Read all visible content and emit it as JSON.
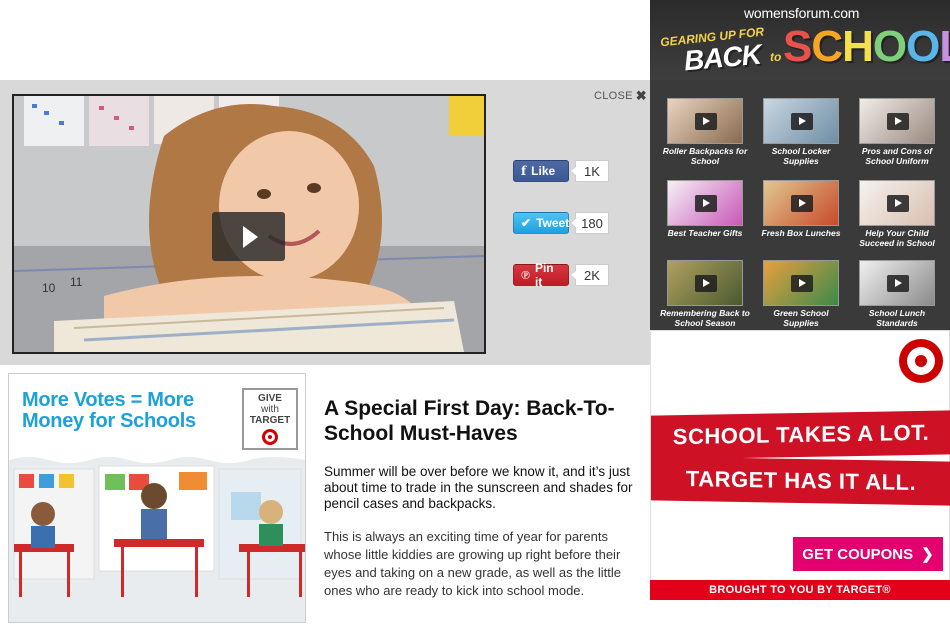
{
  "close": {
    "label": "CLOSE",
    "icon": "close-icon"
  },
  "video": {
    "play_icon": "play-icon"
  },
  "social": {
    "facebook": {
      "label": "Like",
      "count": "1K",
      "icon": "facebook-icon",
      "color": "#3b5998"
    },
    "twitter": {
      "label": "Tweet",
      "count": "180",
      "icon": "twitter-icon",
      "color": "#1ea1e0"
    },
    "pinterest": {
      "label": "Pin it",
      "count": "2K",
      "icon": "pinterest-icon",
      "color": "#bd1e26"
    }
  },
  "promo": {
    "headline_line1": "More Votes = More",
    "headline_line2": "Money for Schools",
    "badge_line1": "GIVE",
    "badge_line2": "with",
    "badge_line3": "TARGET"
  },
  "article": {
    "title": "A Special First Day: Back-To-School Must-Haves",
    "lead": "Summer will be over before we know it, and it’s just about time to trade in the sunscreen and shades for pencil cases and backpacks.",
    "body": "This is always an exciting time of year for parents whose little kiddies are growing up right before their eyes and taking on a new grade, as well as the little ones who are ready to kick into school mode."
  },
  "sidebar": {
    "logo": "womensforum.com",
    "banner_line1": "GEARING UP FOR",
    "banner_line2": "BACK",
    "banner_to": "to",
    "banner_line3": "SCHOOL",
    "videos": [
      {
        "label": "Roller Backpacks for School"
      },
      {
        "label": "School Locker Supplies"
      },
      {
        "label": "Pros and Cons of School Uniform"
      },
      {
        "label": "Best Teacher Gifts"
      },
      {
        "label": "Fresh Box Lunches"
      },
      {
        "label": "Help Your Child Succeed in School"
      },
      {
        "label": "Remembering  Back to School Season"
      },
      {
        "label": "Green School Supplies"
      },
      {
        "label": "School Lunch Standards"
      }
    ]
  },
  "target_ad": {
    "line1": "SCHOOL TAKES A LOT.",
    "line2": "TARGET HAS IT ALL.",
    "cta": "GET COUPONS",
    "cta_icon": "chevron-right-icon",
    "footer": "BROUGHT TO YOU BY TARGET®",
    "brand_color": "#cc0000"
  }
}
